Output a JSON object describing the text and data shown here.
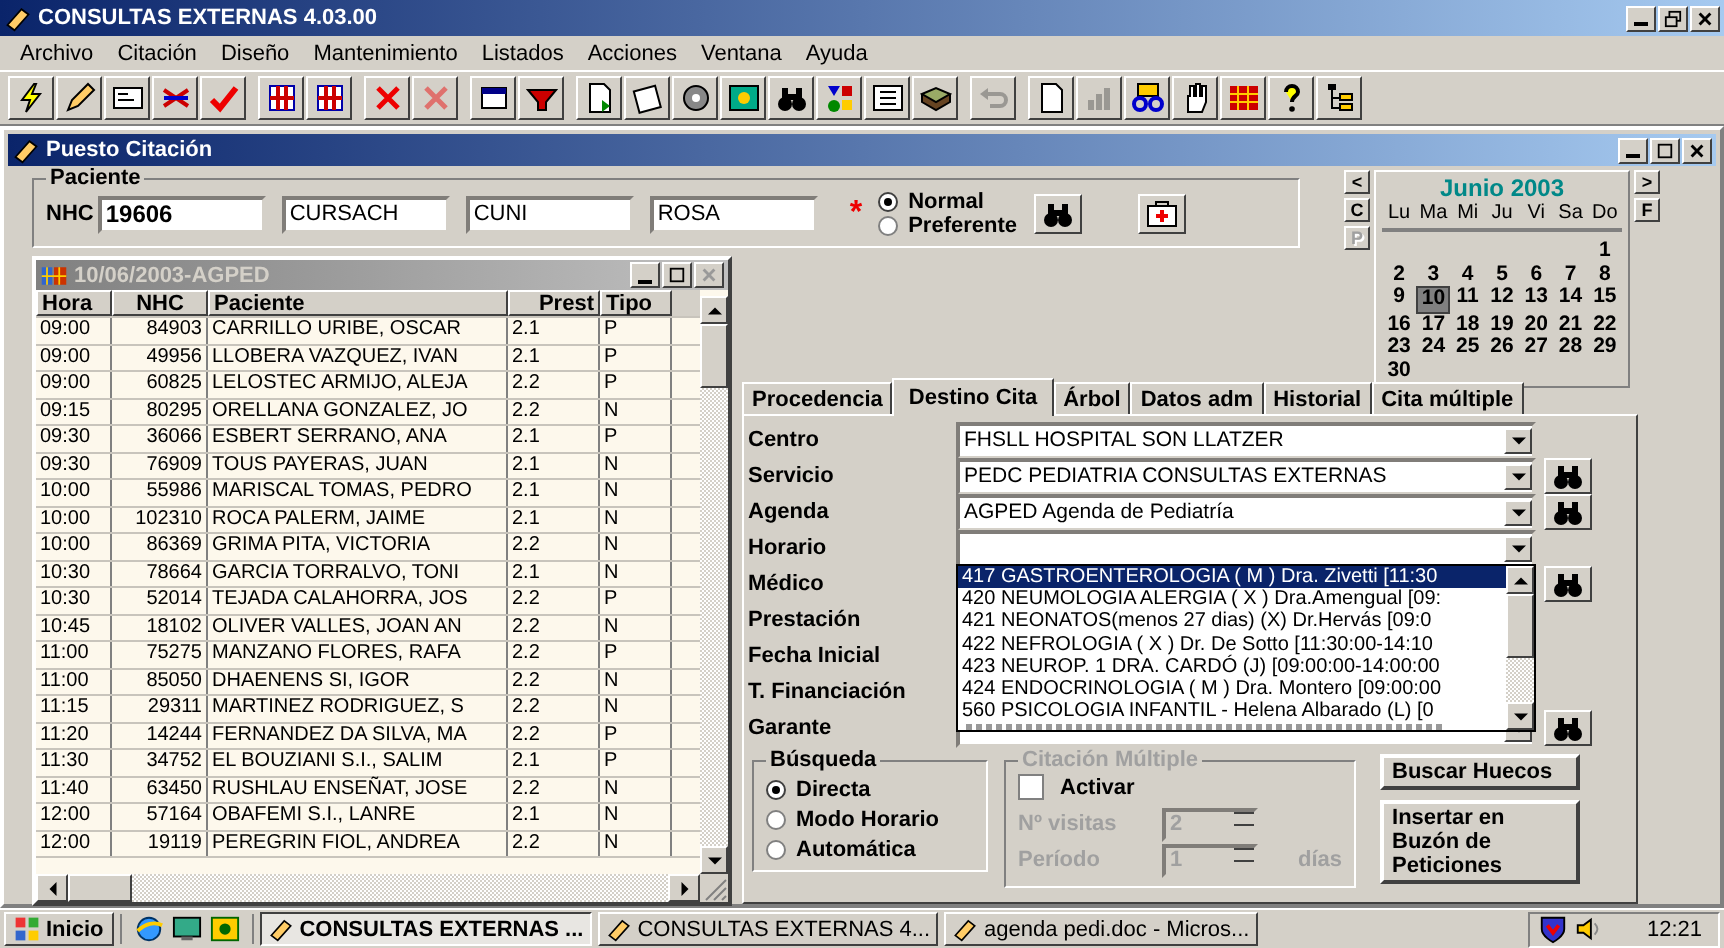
{
  "window": {
    "title": "CONSULTAS EXTERNAS 4.03.00"
  },
  "menu": [
    "Archivo",
    "Citación",
    "Diseño",
    "Mantenimiento",
    "Listados",
    "Acciones",
    "Ventana",
    "Ayuda"
  ],
  "toolbar": [
    [
      {
        "kind": "bolt",
        "disabled": false
      },
      {
        "kind": "pencil",
        "disabled": false
      },
      {
        "kind": "form",
        "disabled": false
      },
      {
        "kind": "arrows",
        "disabled": false
      },
      {
        "kind": "check",
        "disabled": false
      }
    ],
    [
      {
        "kind": "grid",
        "disabled": false
      },
      {
        "kind": "grid",
        "disabled": false
      }
    ],
    [
      {
        "kind": "cross",
        "disabled": false
      },
      {
        "kind": "cross",
        "disabled": true
      }
    ],
    [
      {
        "kind": "window",
        "disabled": false
      },
      {
        "kind": "funnel",
        "disabled": false
      }
    ],
    [
      {
        "kind": "doc",
        "disabled": false
      },
      {
        "kind": "notepad",
        "disabled": false
      },
      {
        "kind": "gear",
        "disabled": false
      },
      {
        "kind": "picture",
        "disabled": false
      },
      {
        "kind": "binoculars",
        "disabled": false
      },
      {
        "kind": "shapes",
        "disabled": false
      },
      {
        "kind": "list",
        "disabled": false
      },
      {
        "kind": "book",
        "disabled": false
      }
    ],
    [
      {
        "kind": "undo",
        "disabled": true
      }
    ],
    [
      {
        "kind": "page",
        "disabled": false
      },
      {
        "kind": "chart",
        "disabled": true
      },
      {
        "kind": "glasses",
        "disabled": false
      },
      {
        "kind": "hand",
        "disabled": false
      },
      {
        "kind": "table",
        "disabled": false
      },
      {
        "kind": "help",
        "disabled": false
      },
      {
        "kind": "tree",
        "disabled": false
      }
    ]
  ],
  "child_window": {
    "title": "Puesto Citación"
  },
  "paciente": {
    "legend": "Paciente",
    "nhc_label": "NHC",
    "nhc": "19606",
    "apellido1": "CURSACH",
    "apellido2": "CUNI",
    "nombre": "ROSA",
    "required_mark": "*",
    "priority": [
      {
        "label": "Normal",
        "selected": true
      },
      {
        "label": "Preferente",
        "selected": false
      }
    ]
  },
  "calendar": {
    "title": "Junio 2003",
    "weekdays": [
      "Lu",
      "Ma",
      "Mi",
      "Ju",
      "Vi",
      "Sa",
      "Do"
    ],
    "nav_left": [
      {
        "label": "<",
        "disabled": false
      },
      {
        "label": "C",
        "disabled": false
      },
      {
        "label": "P",
        "disabled": true
      }
    ],
    "nav_right": [
      {
        "label": ">",
        "disabled": false
      },
      {
        "label": "F",
        "disabled": false
      }
    ],
    "weeks": [
      [
        {
          "day": "1",
          "selected": false
        }
      ],
      [
        {
          "day": "2",
          "selected": false
        },
        {
          "day": "3",
          "selected": false
        },
        {
          "day": "4",
          "selected": false
        },
        {
          "day": "5",
          "selected": false
        },
        {
          "day": "6",
          "selected": false
        },
        {
          "day": "7",
          "selected": false
        },
        {
          "day": "8",
          "selected": false
        }
      ],
      [
        {
          "day": "9",
          "selected": false
        },
        {
          "day": "10",
          "selected": true
        },
        {
          "day": "11",
          "selected": false
        },
        {
          "day": "12",
          "selected": false
        },
        {
          "day": "13",
          "selected": false
        },
        {
          "day": "14",
          "selected": false
        },
        {
          "day": "15",
          "selected": false
        }
      ],
      [
        {
          "day": "16",
          "selected": false
        },
        {
          "day": "17",
          "selected": false
        },
        {
          "day": "18",
          "selected": false
        },
        {
          "day": "19",
          "selected": false
        },
        {
          "day": "20",
          "selected": false
        },
        {
          "day": "21",
          "selected": false
        },
        {
          "day": "22",
          "selected": false
        }
      ],
      [
        {
          "day": "23",
          "selected": false
        },
        {
          "day": "24",
          "selected": false
        },
        {
          "day": "25",
          "selected": false
        },
        {
          "day": "26",
          "selected": false
        },
        {
          "day": "27",
          "selected": false
        },
        {
          "day": "28",
          "selected": false
        },
        {
          "day": "29",
          "selected": false
        }
      ],
      [
        {
          "day": "30",
          "selected": false
        }
      ]
    ]
  },
  "agenda_window": {
    "title": "10/06/2003-AGPED",
    "columns": [
      "Hora",
      "NHC",
      "Paciente",
      "Prest",
      "Tipo"
    ],
    "rows": [
      [
        "09:00",
        "84903",
        "CARRILLO URIBE, OSCAR",
        "2.1",
        "P"
      ],
      [
        "09:00",
        "49956",
        "LLOBERA VAZQUEZ, IVAN",
        "2.1",
        "P"
      ],
      [
        "09:00",
        "60825",
        "LELOSTEC ARMIJO, ALEJA",
        "2.2",
        "P"
      ],
      [
        "09:15",
        "80295",
        "ORELLANA GONZALEZ, JO",
        "2.2",
        "N"
      ],
      [
        "09:30",
        "36066",
        "ESBERT SERRANO, ANA",
        "2.1",
        "P"
      ],
      [
        "09:30",
        "76909",
        "TOUS PAYERAS, JUAN",
        "2.1",
        "N"
      ],
      [
        "10:00",
        "55986",
        "MARISCAL TOMAS, PEDRO",
        "2.1",
        "N"
      ],
      [
        "10:00",
        "102310",
        "ROCA PALERM, JAIME",
        "2.1",
        "N"
      ],
      [
        "10:00",
        "86369",
        "GRIMA PITA, VICTORIA",
        "2.2",
        "N"
      ],
      [
        "10:30",
        "78664",
        "GARCIA TORRALVO, TONI",
        "2.1",
        "N"
      ],
      [
        "10:30",
        "52014",
        "TEJADA CALAHORRA, JOS",
        "2.2",
        "P"
      ],
      [
        "10:45",
        "18102",
        "OLIVER VALLES, JOAN AN",
        "2.2",
        "N"
      ],
      [
        "11:00",
        "75275",
        "MANZANO FLORES, RAFA",
        "2.2",
        "P"
      ],
      [
        "11:00",
        "85050",
        "DHAENENS SI, IGOR",
        "2.2",
        "N"
      ],
      [
        "11:15",
        "29311",
        "MARTINEZ RODRIGUEZ, S",
        "2.2",
        "N"
      ],
      [
        "11:20",
        "14244",
        "FERNANDEZ DA SILVA, MA",
        "2.2",
        "P"
      ],
      [
        "11:30",
        "34752",
        "EL BOUZIANI S.I., SALIM",
        "2.1",
        "P"
      ],
      [
        "11:40",
        "63450",
        "RUSHLAU ENSEÑAT, JOSE",
        "2.2",
        "N"
      ],
      [
        "12:00",
        "57164",
        "OBAFEMI S.I., LANRE",
        "2.1",
        "N"
      ],
      [
        "12:00",
        "19119",
        "PEREGRIN FIOL, ANDREA",
        "2.2",
        "N"
      ]
    ]
  },
  "tabs": [
    {
      "label": "Procedencia",
      "selected": false
    },
    {
      "label": "Destino Cita",
      "selected": true
    },
    {
      "label": "Árbol",
      "selected": false
    },
    {
      "label": "Datos adm",
      "selected": false
    },
    {
      "label": "Historial",
      "selected": false
    },
    {
      "label": "Cita múltiple",
      "selected": false
    }
  ],
  "form": [
    {
      "label": "Centro",
      "kind": "combo",
      "value": "FHSLL HOSPITAL SON LLATZER",
      "search": false
    },
    {
      "label": "Servicio",
      "kind": "combo",
      "value": "PEDC PEDIATRIA CONSULTAS EXTERNAS",
      "search": true
    },
    {
      "label": "Agenda",
      "kind": "combo",
      "value": "AGPED Agenda de Pediatría",
      "search": true
    },
    {
      "label": "Horario",
      "kind": "open",
      "search": false
    },
    {
      "label": "Médico",
      "kind": "blank",
      "search": true
    },
    {
      "label": "Prestación",
      "kind": "blank",
      "search": false
    },
    {
      "label": "Fecha Inicial",
      "kind": "blank",
      "search": false
    },
    {
      "label": "T. Financiación",
      "kind": "blank",
      "search": false
    },
    {
      "label": "Garante",
      "kind": "combo",
      "search": true
    }
  ],
  "horario_options": [
    {
      "label": "417 GASTROENTEROLOGIA ( M ) Dra. Zivetti [11:30",
      "selected": true
    },
    {
      "label": "420 NEUMOLOGIA ALERGIA ( X ) Dra.Amengual [09:",
      "selected": false
    },
    {
      "label": "421 NEONATOS(menos 27 dias) (X) Dr.Hervás [09:0",
      "selected": false
    },
    {
      "label": "422 NEFROLOGIA ( X ) Dr. De Sotto [11:30:00-14:10",
      "selected": false
    },
    {
      "label": "423 NEUROP. 1 DRA. CARDÓ (J) [09:00:00-14:00:00",
      "selected": false
    },
    {
      "label": "424 ENDOCRINOLOGIA  ( M ) Dra. Montero [09:00:00",
      "selected": false
    },
    {
      "label": "560 PSICOLOGIA INFANTIL - Helena Albarado (L) [0",
      "selected": false
    }
  ],
  "busqueda": {
    "legend": "Búsqueda",
    "options": [
      {
        "label": "Directa",
        "selected": true
      },
      {
        "label": "Modo Horario",
        "selected": false
      },
      {
        "label": "Automática",
        "selected": false
      }
    ]
  },
  "citacion_multiple": {
    "legend": "Citación Múltiple",
    "disabled": true,
    "activar": {
      "label": "Activar",
      "checked": false
    },
    "visitas_label": "Nº visitas",
    "visitas": "2",
    "periodo_label": "Período",
    "periodo": "1",
    "unit": "días"
  },
  "buttons": [
    "Buscar Huecos",
    "Insertar en Buzón de Peticiones"
  ],
  "taskbar": {
    "start": "Inicio",
    "tasks": [
      {
        "label": "CONSULTAS EXTERNAS ...",
        "selected": true
      },
      {
        "label": "CONSULTAS EXTERNAS 4...",
        "selected": false
      },
      {
        "label": "agenda pedi.doc - Micros...",
        "selected": false
      }
    ],
    "clock": "12:21"
  }
}
